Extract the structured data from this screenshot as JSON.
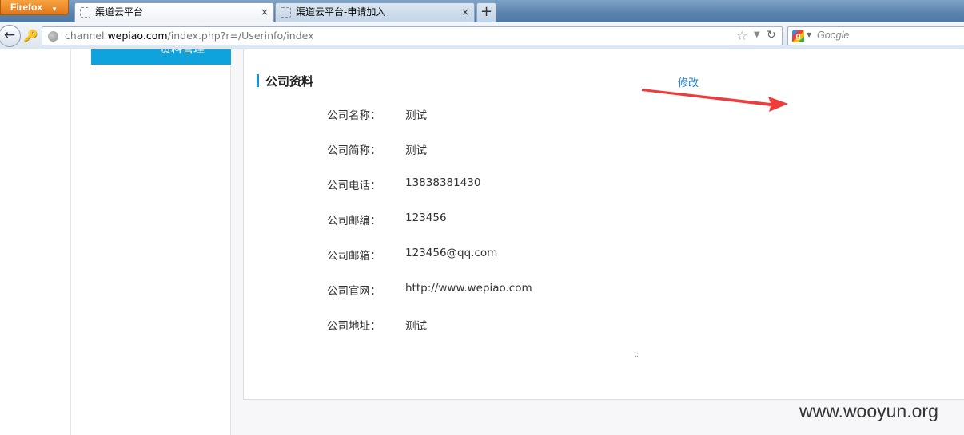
{
  "browser": {
    "app_button_label": "Firefox",
    "tabs": [
      {
        "title": "渠道云平台",
        "active": true,
        "close": "×"
      },
      {
        "title": "渠道云平台-申请加入",
        "active": false,
        "close": "×"
      }
    ],
    "new_tab_label": "+",
    "url": {
      "prefix": "channel.",
      "host": "wepiao.com",
      "path": "/index.php?r=/Userinfo/index"
    },
    "search_placeholder": "Google"
  },
  "sidebar": {
    "active_item_label": "资料管理"
  },
  "main": {
    "section_title": "公司资料",
    "edit_label": "修改",
    "fields": [
      {
        "label": "公司名称：",
        "value": "测试"
      },
      {
        "label": "公司简称：",
        "value": "测试"
      },
      {
        "label": "公司电话：",
        "value": "13838381430"
      },
      {
        "label": "公司邮编：",
        "value": "123456"
      },
      {
        "label": "公司邮箱：",
        "value": "123456@qq.com"
      },
      {
        "label": "公司官网：",
        "value": "http://www.wepiao.com"
      },
      {
        "label": "公司地址：",
        "value": "测试"
      }
    ]
  },
  "annotation": {
    "arrow_color": "#ee3b3b"
  },
  "watermark": "www.wooyun.org",
  "colors": {
    "accent": "#0fa3de",
    "link": "#1a7bc9",
    "firefox_orange": "#e3761a"
  }
}
